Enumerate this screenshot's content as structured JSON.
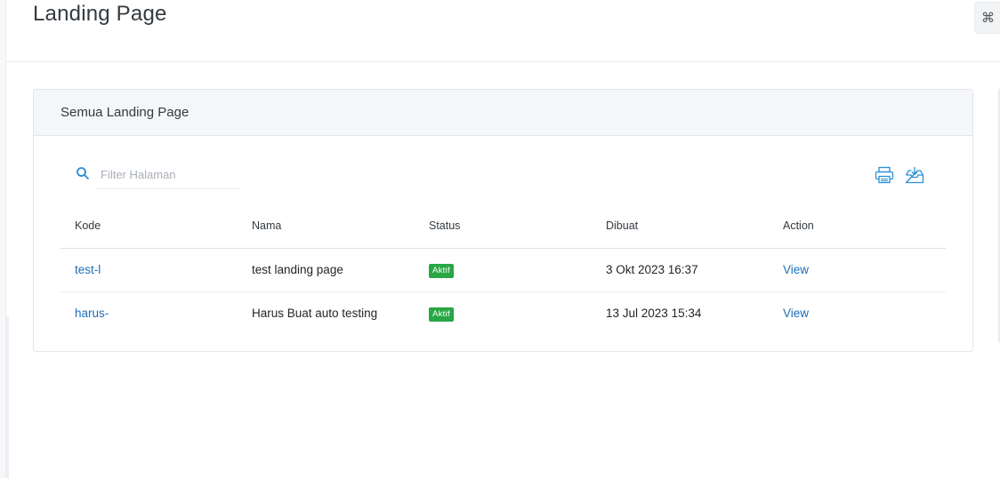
{
  "header": {
    "title": "Landing Page",
    "command_icon": "⌘"
  },
  "card": {
    "title": "Semua Landing Page"
  },
  "search": {
    "placeholder": "Filter Halaman",
    "value": ""
  },
  "toolbar": {
    "print_icon": "printer-icon",
    "download_icon": "download-tray-icon"
  },
  "table": {
    "columns": [
      "Kode",
      "Nama",
      "Status",
      "Dibuat",
      "Action"
    ],
    "rows": [
      {
        "kode": "test-l",
        "nama": "test landing page",
        "status": "Aktif",
        "dibuat": "3 Okt 2023 16:37",
        "action": "View"
      },
      {
        "kode": "harus-",
        "nama": "Harus Buat auto testing",
        "status": "Aktif",
        "dibuat": "13 Jul 2023 15:34",
        "action": "View"
      }
    ]
  },
  "colors": {
    "accent": "#1e6fb8",
    "success": "#28a745",
    "icon": "#2a8fd6"
  }
}
